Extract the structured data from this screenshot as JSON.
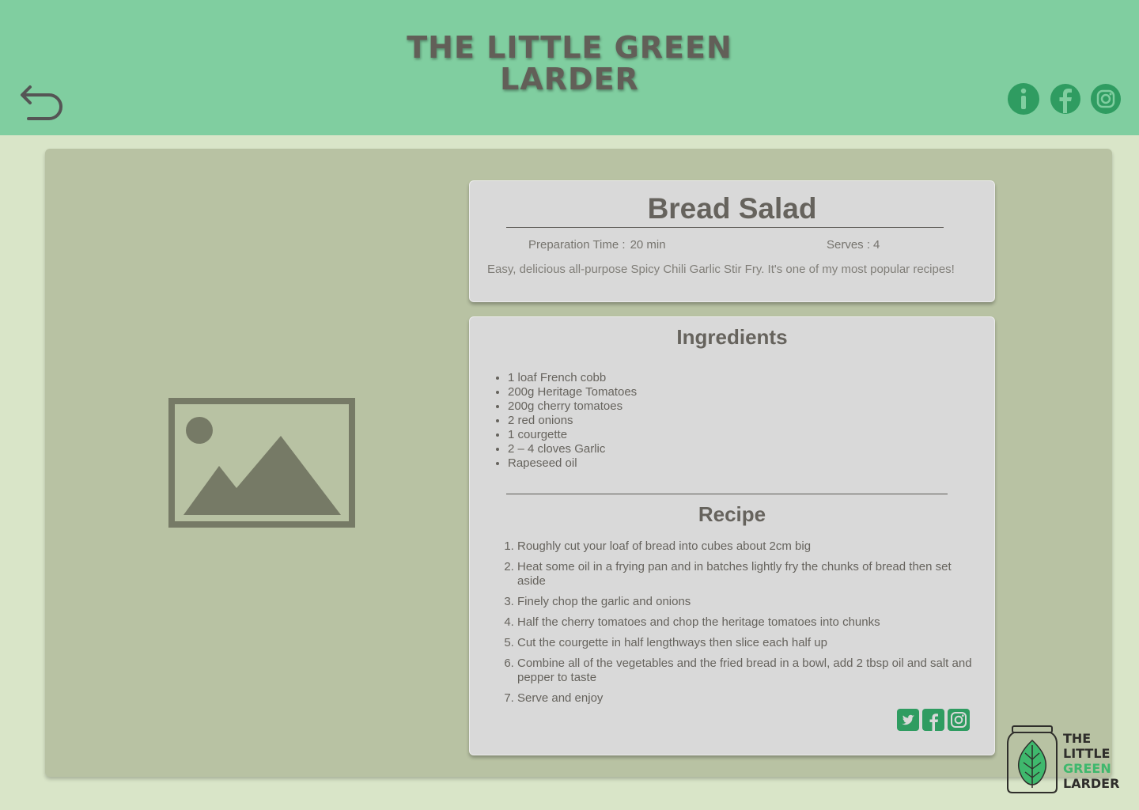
{
  "header": {
    "site_title_line1": "THE LITTLE GREEN",
    "site_title_line2": "LARDER",
    "back_icon": "back-arrow-icon",
    "social_icons": [
      "info-icon",
      "facebook-icon",
      "instagram-icon"
    ],
    "icon_color": "#2f9c61",
    "background": "#80cea0"
  },
  "recipe": {
    "title": "Bread Salad",
    "prep_label": "Preparation Time :",
    "prep_value": "20 min",
    "serves_label": "Serves :",
    "serves_value": "4",
    "description": "Easy, delicious all-purpose Spicy Chili Garlic Stir Fry. It's one of my most popular recipes!",
    "image_icon": "image-placeholder-icon"
  },
  "ingredients": {
    "heading": "Ingredients",
    "items": [
      "1 loaf French cobb",
      "200g Heritage Tomatoes",
      "200g cherry tomatoes",
      "2 red onions",
      "1 courgette",
      "2 – 4 cloves Garlic",
      "Rapeseed oil"
    ]
  },
  "method": {
    "heading": "Recipe",
    "steps": [
      "Roughly cut your loaf of bread into cubes about 2cm big",
      "Heat some oil in a frying pan and in batches lightly fry the chunks of bread then set aside",
      "Finely chop the garlic and onions",
      "Half the cherry tomatoes and chop the heritage tomatoes into chunks",
      "Cut the courgette in half lengthways then slice each half up",
      "Combine all of the vegetables and the fried bread in a bowl, add 2 tbsp oil and salt and pepper to taste",
      "Serve and enjoy"
    ]
  },
  "share": {
    "icons": [
      "twitter-icon",
      "facebook-icon",
      "instagram-icon"
    ]
  },
  "logo": {
    "words": [
      "THE",
      "LITTLE",
      "GREEN",
      "LARDER"
    ],
    "accent": "#3fb86d"
  }
}
